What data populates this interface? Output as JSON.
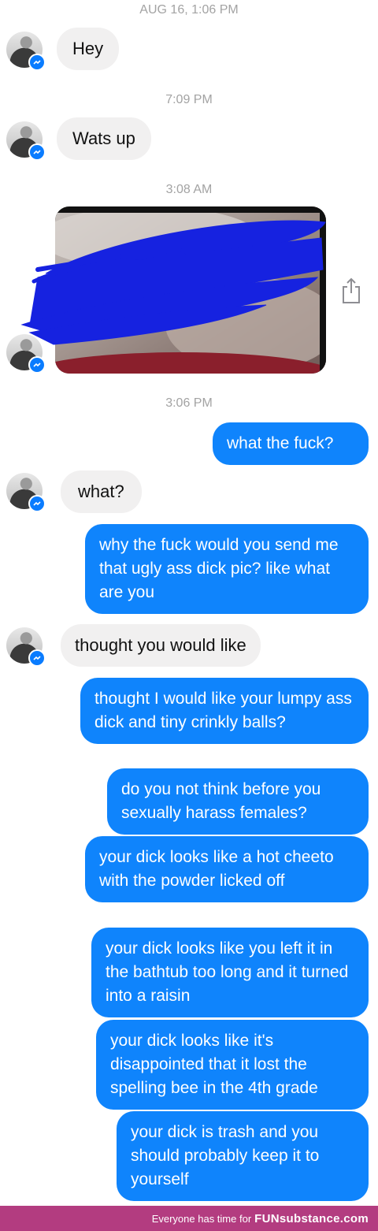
{
  "timestamps": [
    "AUG 16, 1:06 PM",
    "7:09 PM",
    "3:08 AM",
    "3:06 PM"
  ],
  "incoming": [
    "Hey",
    "Wats up",
    "what?",
    "thought you would like"
  ],
  "outgoing": [
    "what the fuck?",
    "why the fuck would you send me that ugly ass dick pic? like what are you",
    "thought I would like your lumpy ass dick and tiny crinkly balls?",
    "do you not think before you sexually harass females?",
    "your dick looks like a hot cheeto with the powder licked off",
    "your dick looks like you left it in the bathtub too long and it turned into a raisin",
    "your dick looks like it's disappointed that it lost the spelling bee in the 4th grade",
    "your dick is trash and you should probably keep it to yourself"
  ],
  "footer": {
    "text": "Everyone has time for",
    "brand": "FUNsubstance.com"
  },
  "colors": {
    "outgoing_bubble": "#0f84fc",
    "incoming_bubble": "#f1f0f0",
    "messenger_badge": "#0a7cff",
    "footer_bar": "#b33c80",
    "redaction": "#1622e0"
  },
  "icons": [
    "avatar",
    "messenger-badge-icon",
    "share-icon"
  ]
}
